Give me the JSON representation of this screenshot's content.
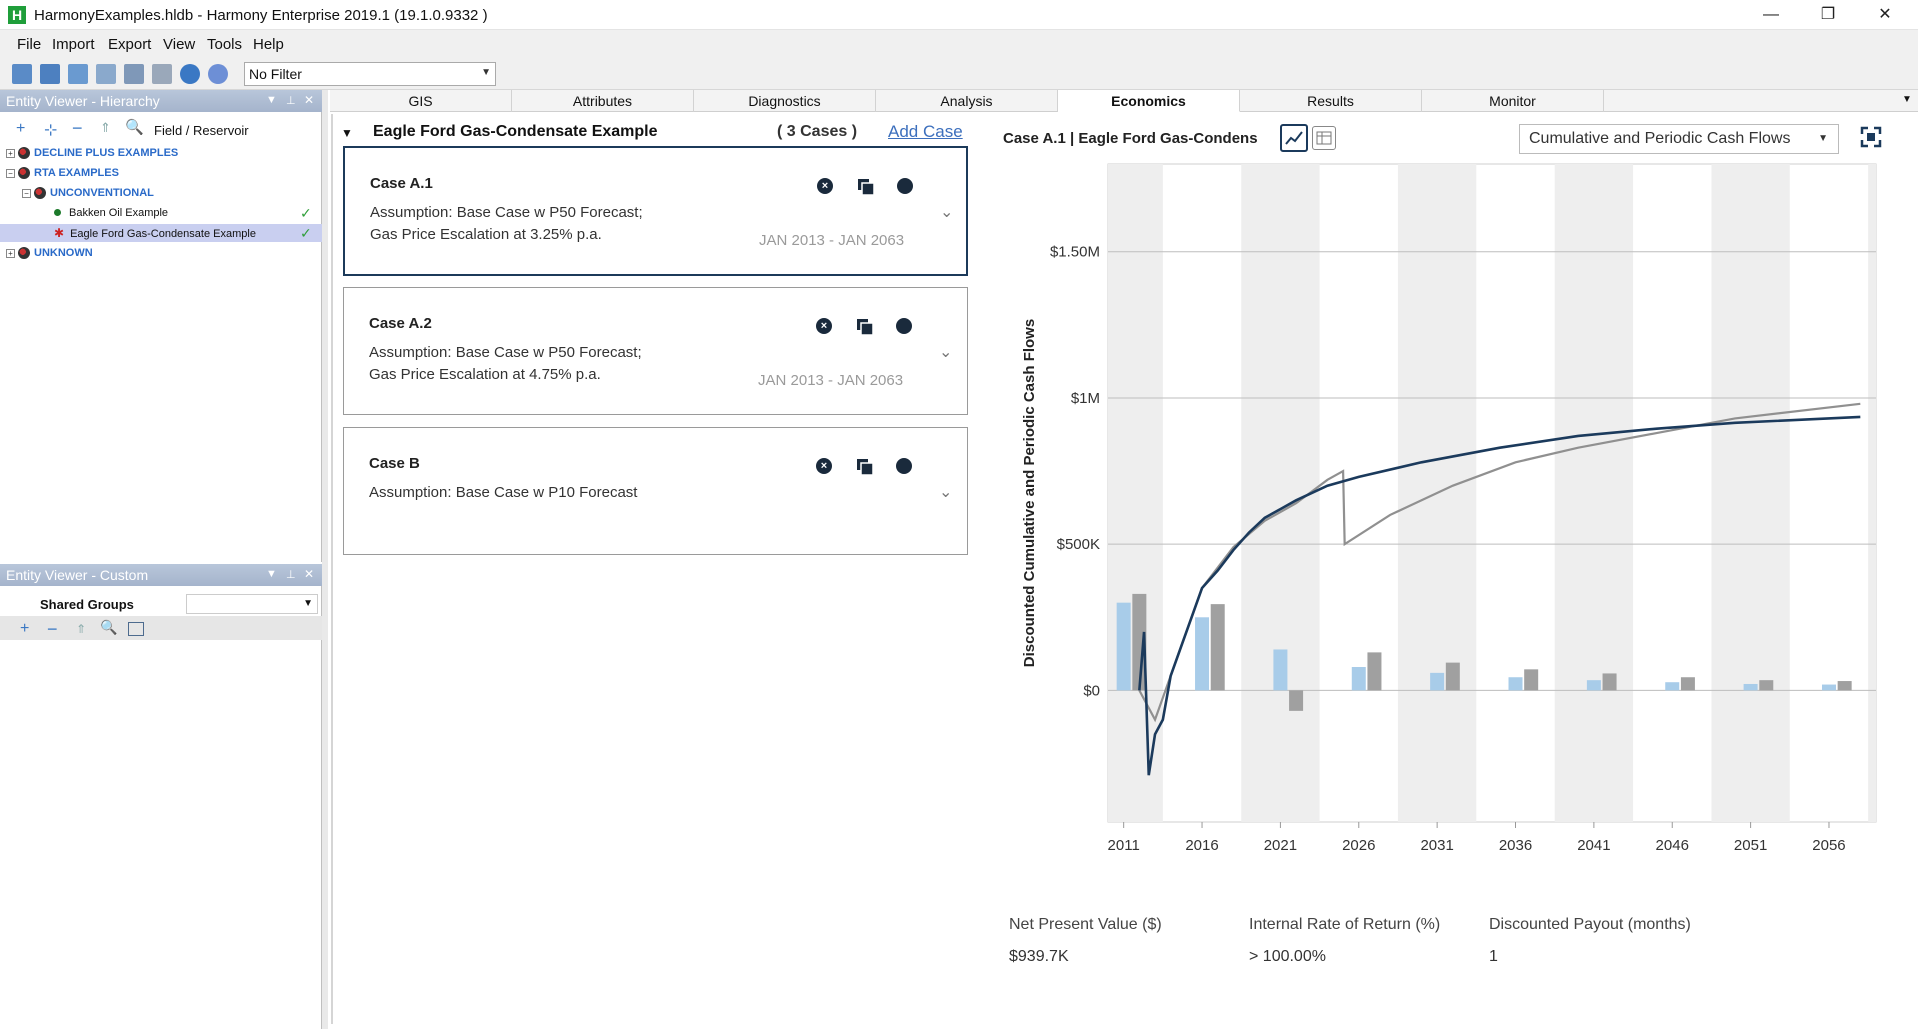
{
  "window": {
    "title": "HarmonyExamples.hldb - Harmony Enterprise 2019.1  (19.1.0.9332 )",
    "app_icon_letter": "H",
    "minimize": "—",
    "restore": "❐",
    "close": "✕"
  },
  "menu": [
    "File",
    "Import",
    "Export",
    "View",
    "Tools",
    "Help"
  ],
  "toolbar": {
    "filter_value": "No Filter"
  },
  "hierarchy_panel": {
    "title": "Entity Viewer - Hierarchy",
    "field_reservoir": "Field / Reservoir",
    "items": [
      {
        "label": "DECLINE PLUS EXAMPLES"
      },
      {
        "label": "RTA EXAMPLES"
      },
      {
        "label": "UNCONVENTIONAL"
      },
      {
        "label": "Bakken Oil Example"
      },
      {
        "label": "Eagle Ford Gas-Condensate Example"
      },
      {
        "label": "UNKNOWN"
      }
    ]
  },
  "custom_panel": {
    "title": "Entity Viewer - Custom",
    "tab": "Shared Groups"
  },
  "tabs": [
    "GIS",
    "Attributes",
    "Diagnostics",
    "Analysis",
    "Economics",
    "Results",
    "Monitor"
  ],
  "active_tab": "Economics",
  "cases_section": {
    "title": "Eagle Ford Gas-Condensate Example",
    "count": "( 3 Cases )",
    "add_case": "Add Case",
    "cases": [
      {
        "name": "Case A.1",
        "line1": "Assumption: Base Case w P50 Forecast;",
        "line2": "Gas Price Escalation at 3.25% p.a.",
        "dates": "JAN 2013 - JAN 2063"
      },
      {
        "name": "Case A.2",
        "line1": "Assumption: Base Case w P50 Forecast;",
        "line2": "Gas Price Escalation at 4.75% p.a.",
        "dates": "JAN 2013 - JAN 2063"
      },
      {
        "name": "Case B",
        "line1": "Assumption: Base Case w P10 Forecast",
        "line2": "",
        "dates": ""
      }
    ]
  },
  "chart_header": {
    "case_title": "Case A.1  |  Eagle Ford Gas-Condens",
    "chart_selector": "Cumulative and Periodic Cash Flows"
  },
  "kpis": [
    {
      "label": "Net Present Value ($)",
      "value": "$939.7K"
    },
    {
      "label": "Internal Rate of Return (%)",
      "value": "> 100.00%"
    },
    {
      "label": "Discounted Payout (months)",
      "value": "1"
    }
  ],
  "chart_data": {
    "type": "bar",
    "ylabel": "Discounted Cumulative and Periodic Cash Flows",
    "xlabel": "",
    "xticks": [
      "2011",
      "2016",
      "2021",
      "2026",
      "2031",
      "2036",
      "2041",
      "2046",
      "2051",
      "2056"
    ],
    "yticks": [
      "$0",
      "$500K",
      "$1M",
      "$1.50M"
    ],
    "xlim": [
      2010,
      2059
    ],
    "ylim": [
      -450000,
      1800000
    ],
    "colors": {
      "series1": "#a8cce9",
      "series2": "#a0a0a0",
      "line1": "#1b3a5c",
      "line2": "#909090"
    },
    "bars_series1": {
      "x": [
        2011,
        2016,
        2021,
        2026,
        2031,
        2036,
        2041,
        2046,
        2051,
        2056
      ],
      "values": [
        300000,
        250000,
        140000,
        80000,
        60000,
        45000,
        35000,
        28000,
        22000,
        20000
      ]
    },
    "bars_series2": {
      "x": [
        2012,
        2017,
        2022,
        2027,
        2032,
        2037,
        2042,
        2047,
        2052,
        2057
      ],
      "values": [
        330000,
        295000,
        -70000,
        130000,
        95000,
        72000,
        58000,
        45000,
        35000,
        32000
      ]
    },
    "line_series1": {
      "x": [
        2012.0,
        2012.3,
        2012.6,
        2013.0,
        2013.5,
        2014.0,
        2015.0,
        2016.0,
        2017.0,
        2018.0,
        2019.0,
        2020.0,
        2021.0,
        2022.0,
        2024.0,
        2026.0,
        2030.0,
        2035.0,
        2040.0,
        2045.0,
        2050.0,
        2058.0
      ],
      "values": [
        0,
        200000,
        -290000,
        -150000,
        -100000,
        50000,
        200000,
        350000,
        410000,
        480000,
        540000,
        590000,
        620000,
        650000,
        700000,
        730000,
        780000,
        830000,
        870000,
        895000,
        915000,
        935000
      ]
    },
    "line_series2": {
      "x": [
        2012.0,
        2013.0,
        2014.0,
        2016.0,
        2018.0,
        2020.0,
        2022.0,
        2024.0,
        2025.0,
        2025.1,
        2028.0,
        2032.0,
        2036.0,
        2040.0,
        2045.0,
        2050.0,
        2058.0
      ],
      "values": [
        0,
        -100000,
        50000,
        350000,
        490000,
        580000,
        640000,
        720000,
        750000,
        500000,
        600000,
        700000,
        780000,
        830000,
        880000,
        930000,
        980000
      ]
    }
  }
}
